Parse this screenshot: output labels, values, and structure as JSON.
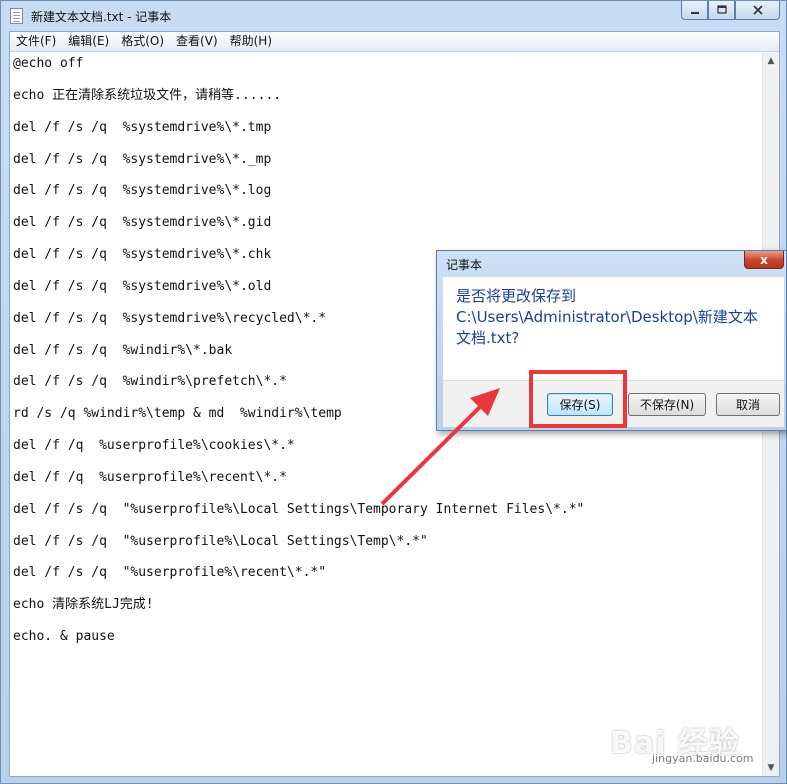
{
  "window": {
    "title": "新建文本文档.txt - 记事本",
    "min_icon": "minimize-icon",
    "max_icon": "maximize-icon",
    "close_icon": "close-icon"
  },
  "menu": [
    {
      "label": "文件(F)"
    },
    {
      "label": "编辑(E)"
    },
    {
      "label": "格式(O)"
    },
    {
      "label": "查看(V)"
    },
    {
      "label": "帮助(H)"
    }
  ],
  "editor_lines": [
    "@echo off",
    "echo 正在清除系统垃圾文件，请稍等......",
    "del /f /s /q  %systemdrive%\\*.tmp",
    "del /f /s /q  %systemdrive%\\*._mp",
    "del /f /s /q  %systemdrive%\\*.log",
    "del /f /s /q  %systemdrive%\\*.gid",
    "del /f /s /q  %systemdrive%\\*.chk",
    "del /f /s /q  %systemdrive%\\*.old",
    "del /f /s /q  %systemdrive%\\recycled\\*.*",
    "del /f /s /q  %windir%\\*.bak",
    "del /f /s /q  %windir%\\prefetch\\*.*",
    "rd /s /q %windir%\\temp & md  %windir%\\temp",
    "del /f /q  %userprofile%\\cookies\\*.*",
    "del /f /q  %userprofile%\\recent\\*.*",
    "del /f /s /q  \"%userprofile%\\Local Settings\\Temporary Internet Files\\*.*\"",
    "del /f /s /q  \"%userprofile%\\Local Settings\\Temp\\*.*\"",
    "del /f /s /q  \"%userprofile%\\recent\\*.*\"",
    "echo 清除系统LJ完成!",
    "echo. & pause"
  ],
  "dialog": {
    "title": "记事本",
    "message_line1": "是否将更改保存到",
    "message_line2": "C:\\Users\\Administrator\\Desktop\\新建文本",
    "message_line3": "文档.txt?",
    "save_label": "保存(S)",
    "dont_save_label": "不保存(N)",
    "cancel_label": "取消",
    "close_glyph": "x"
  },
  "annotation": {
    "highlight_color": "#e8383d",
    "arrow_color": "#e8383d"
  },
  "watermark": {
    "brand": "Bai 经验",
    "url": "jingyan.baidu.com"
  }
}
